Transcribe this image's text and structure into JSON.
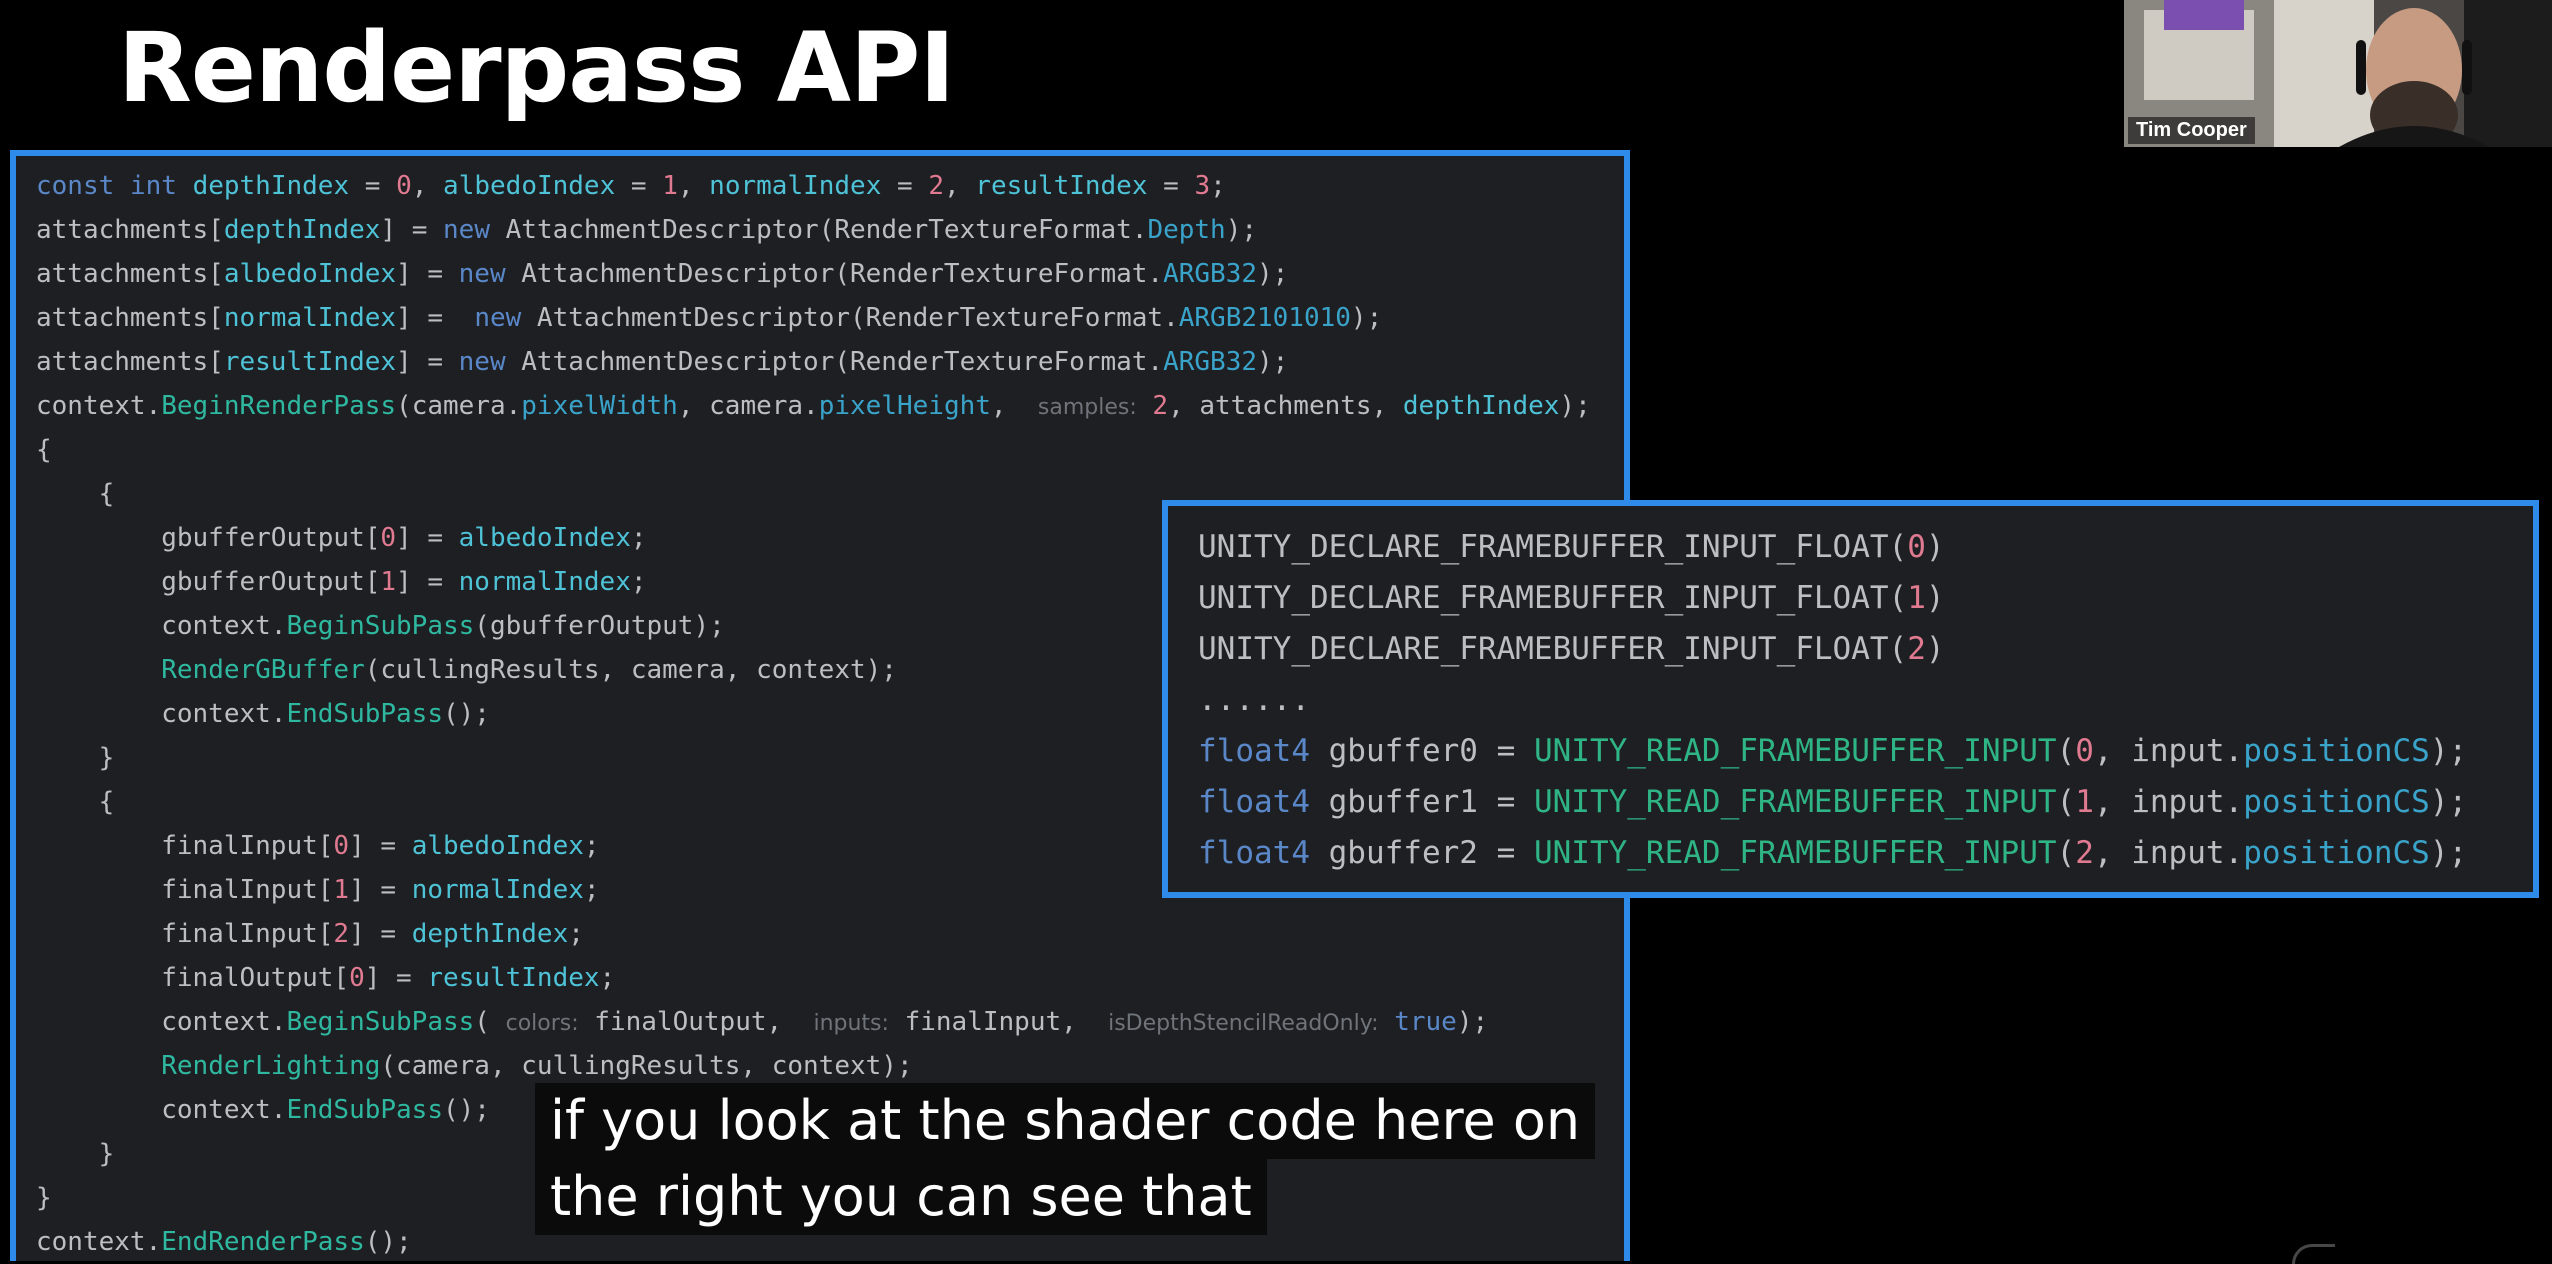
{
  "slide": {
    "title": "Renderpass API"
  },
  "code_panel": {
    "lines": [
      [
        {
          "t": "const",
          "c": "kw"
        },
        {
          "t": " "
        },
        {
          "t": "int",
          "c": "kw"
        },
        {
          "t": " "
        },
        {
          "t": "depthIndex",
          "c": "field"
        },
        {
          "t": " = "
        },
        {
          "t": "0",
          "c": "num"
        },
        {
          "t": ", "
        },
        {
          "t": "albedoIndex",
          "c": "field"
        },
        {
          "t": " = "
        },
        {
          "t": "1",
          "c": "num"
        },
        {
          "t": ", "
        },
        {
          "t": "normalIndex",
          "c": "field"
        },
        {
          "t": " = "
        },
        {
          "t": "2",
          "c": "num"
        },
        {
          "t": ", "
        },
        {
          "t": "resultIndex",
          "c": "field"
        },
        {
          "t": " = "
        },
        {
          "t": "3",
          "c": "num"
        },
        {
          "t": ";"
        }
      ],
      [
        {
          "t": "attachments["
        },
        {
          "t": "depthIndex",
          "c": "field"
        },
        {
          "t": "] = "
        },
        {
          "t": "new",
          "c": "kw"
        },
        {
          "t": " AttachmentDescriptor(RenderTextureFormat."
        },
        {
          "t": "Depth",
          "c": "param"
        },
        {
          "t": ");"
        }
      ],
      [
        {
          "t": "attachments["
        },
        {
          "t": "albedoIndex",
          "c": "field"
        },
        {
          "t": "] = "
        },
        {
          "t": "new",
          "c": "kw"
        },
        {
          "t": " AttachmentDescriptor(RenderTextureFormat."
        },
        {
          "t": "ARGB32",
          "c": "param"
        },
        {
          "t": ");"
        }
      ],
      [
        {
          "t": "attachments["
        },
        {
          "t": "normalIndex",
          "c": "field"
        },
        {
          "t": "] =  "
        },
        {
          "t": "new",
          "c": "kw"
        },
        {
          "t": " AttachmentDescriptor(RenderTextureFormat."
        },
        {
          "t": "ARGB2101010",
          "c": "param"
        },
        {
          "t": ");"
        }
      ],
      [
        {
          "t": "attachments["
        },
        {
          "t": "resultIndex",
          "c": "field"
        },
        {
          "t": "] = "
        },
        {
          "t": "new",
          "c": "kw"
        },
        {
          "t": " AttachmentDescriptor(RenderTextureFormat."
        },
        {
          "t": "ARGB32",
          "c": "param"
        },
        {
          "t": ");"
        }
      ],
      [
        {
          "t": "context."
        },
        {
          "t": "BeginRenderPass",
          "c": "method"
        },
        {
          "t": "(camera."
        },
        {
          "t": "pixelWidth",
          "c": "param"
        },
        {
          "t": ", camera."
        },
        {
          "t": "pixelHeight",
          "c": "param"
        },
        {
          "t": ",  "
        },
        {
          "t": "samples:",
          "c": "hint"
        },
        {
          "t": " "
        },
        {
          "t": "2",
          "c": "num"
        },
        {
          "t": ", attachments, "
        },
        {
          "t": "depthIndex",
          "c": "field"
        },
        {
          "t": ");"
        }
      ],
      [
        {
          "t": "{"
        }
      ],
      [
        {
          "t": "    {"
        }
      ],
      [
        {
          "t": "        gbufferOutput["
        },
        {
          "t": "0",
          "c": "num"
        },
        {
          "t": "] = "
        },
        {
          "t": "albedoIndex",
          "c": "field"
        },
        {
          "t": ";"
        }
      ],
      [
        {
          "t": "        gbufferOutput["
        },
        {
          "t": "1",
          "c": "num"
        },
        {
          "t": "] = "
        },
        {
          "t": "normalIndex",
          "c": "field"
        },
        {
          "t": ";"
        }
      ],
      [
        {
          "t": "        context."
        },
        {
          "t": "BeginSubPass",
          "c": "method"
        },
        {
          "t": "(gbufferOutput);"
        }
      ],
      [
        {
          "t": "        "
        },
        {
          "t": "RenderGBuffer",
          "c": "method"
        },
        {
          "t": "(cullingResults, camera, context);"
        }
      ],
      [
        {
          "t": "        context."
        },
        {
          "t": "EndSubPass",
          "c": "method"
        },
        {
          "t": "();"
        }
      ],
      [
        {
          "t": "    }"
        }
      ],
      [
        {
          "t": "    {"
        }
      ],
      [
        {
          "t": "        finalInput["
        },
        {
          "t": "0",
          "c": "num"
        },
        {
          "t": "] = "
        },
        {
          "t": "albedoIndex",
          "c": "field"
        },
        {
          "t": ";"
        }
      ],
      [
        {
          "t": "        finalInput["
        },
        {
          "t": "1",
          "c": "num"
        },
        {
          "t": "] = "
        },
        {
          "t": "normalIndex",
          "c": "field"
        },
        {
          "t": ";"
        }
      ],
      [
        {
          "t": "        finalInput["
        },
        {
          "t": "2",
          "c": "num"
        },
        {
          "t": "] = "
        },
        {
          "t": "depthIndex",
          "c": "field"
        },
        {
          "t": ";"
        }
      ],
      [
        {
          "t": "        finalOutput["
        },
        {
          "t": "0",
          "c": "num"
        },
        {
          "t": "] = "
        },
        {
          "t": "resultIndex",
          "c": "field"
        },
        {
          "t": ";"
        }
      ],
      [
        {
          "t": "        context."
        },
        {
          "t": "BeginSubPass",
          "c": "method"
        },
        {
          "t": "( "
        },
        {
          "t": "colors:",
          "c": "hint"
        },
        {
          "t": " finalOutput,  "
        },
        {
          "t": "inputs:",
          "c": "hint"
        },
        {
          "t": " finalInput,  "
        },
        {
          "t": "isDepthStencilReadOnly:",
          "c": "hint"
        },
        {
          "t": " "
        },
        {
          "t": "true",
          "c": "kw"
        },
        {
          "t": ");"
        }
      ],
      [
        {
          "t": "        "
        },
        {
          "t": "RenderLighting",
          "c": "method"
        },
        {
          "t": "(camera, cullingResults, context);"
        }
      ],
      [
        {
          "t": "        context."
        },
        {
          "t": "EndSubPass",
          "c": "method"
        },
        {
          "t": "();"
        }
      ],
      [
        {
          "t": "    }"
        }
      ],
      [
        {
          "t": "}"
        }
      ],
      [
        {
          "t": "context."
        },
        {
          "t": "EndRenderPass",
          "c": "method"
        },
        {
          "t": "();"
        }
      ]
    ]
  },
  "shader_panel": {
    "lines": [
      [
        {
          "t": "UNITY_DECLARE_FRAMEBUFFER_INPUT_FLOAT("
        },
        {
          "t": "0",
          "c": "num"
        },
        {
          "t": ")"
        }
      ],
      [
        {
          "t": "UNITY_DECLARE_FRAMEBUFFER_INPUT_FLOAT("
        },
        {
          "t": "1",
          "c": "num"
        },
        {
          "t": ")"
        }
      ],
      [
        {
          "t": "UNITY_DECLARE_FRAMEBUFFER_INPUT_FLOAT("
        },
        {
          "t": "2",
          "c": "num"
        },
        {
          "t": ")"
        }
      ],
      [
        {
          "t": "......"
        }
      ],
      [
        {
          "t": "float4",
          "c": "kw"
        },
        {
          "t": " gbuffer0 = "
        },
        {
          "t": "UNITY_READ_FRAMEBUFFER_INPUT",
          "c": "macro"
        },
        {
          "t": "("
        },
        {
          "t": "0",
          "c": "num"
        },
        {
          "t": ", input."
        },
        {
          "t": "positionCS",
          "c": "param"
        },
        {
          "t": ");"
        }
      ],
      [
        {
          "t": "float4",
          "c": "kw"
        },
        {
          "t": " gbuffer1 = "
        },
        {
          "t": "UNITY_READ_FRAMEBUFFER_INPUT",
          "c": "macro"
        },
        {
          "t": "("
        },
        {
          "t": "1",
          "c": "num"
        },
        {
          "t": ", input."
        },
        {
          "t": "positionCS",
          "c": "param"
        },
        {
          "t": ");"
        }
      ],
      [
        {
          "t": "float4",
          "c": "kw"
        },
        {
          "t": " gbuffer2 = "
        },
        {
          "t": "UNITY_READ_FRAMEBUFFER_INPUT",
          "c": "macro"
        },
        {
          "t": "("
        },
        {
          "t": "2",
          "c": "num"
        },
        {
          "t": ", input."
        },
        {
          "t": "positionCS",
          "c": "param"
        },
        {
          "t": ");"
        }
      ]
    ]
  },
  "webcam": {
    "name": "Tim Cooper"
  },
  "caption": {
    "line1": "if you look at the shader code here on",
    "line2": "the right you can see that"
  },
  "colors": {
    "panel_border": "#2e8bea",
    "editor_bg": "#1e1f22",
    "keyword": "#5a87c8",
    "field": "#4ec2d6",
    "number": "#e07a90",
    "method": "#2fb8a0"
  }
}
